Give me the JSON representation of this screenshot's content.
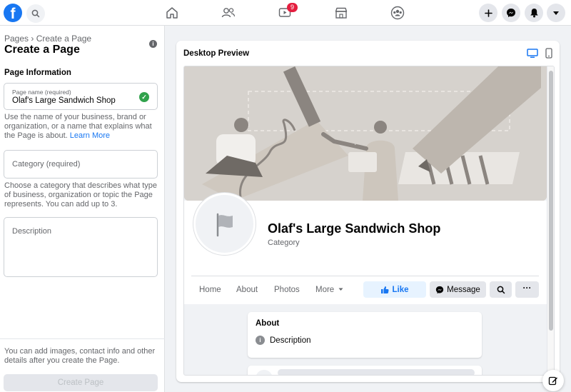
{
  "app": {
    "logo_text": "f",
    "accent_color": "#1877f2"
  },
  "topbar": {
    "notification_badge": "9",
    "icons": [
      "search-icon",
      "home-icon",
      "friends-icon",
      "watch-icon",
      "marketplace-icon",
      "groups-icon",
      "plus-icon",
      "messenger-icon",
      "bell-icon",
      "caret-down-icon"
    ]
  },
  "left_panel": {
    "breadcrumb_root": "Pages",
    "breadcrumb_sep": "›",
    "breadcrumb_current": "Create a Page",
    "title": "Create a Page",
    "section_title": "Page Information",
    "page_name": {
      "label": "Page name (required)",
      "value": "Olaf's Large Sandwich Shop",
      "helper": "Use the name of your business, brand or organization, or a name that explains what the Page is about.",
      "helper_link": "Learn More"
    },
    "category": {
      "placeholder": "Category (required)",
      "helper": "Choose a category that describes what type of business, organization or topic the Page represents. You can add up to 3."
    },
    "description": {
      "placeholder": "Description"
    },
    "bottom_note": "You can add images, contact info and other details after you create the Page.",
    "create_button": "Create Page"
  },
  "preview": {
    "title": "Desktop Preview",
    "page_name": "Olaf's Large Sandwich Shop",
    "category": "Category",
    "tabs": [
      "Home",
      "About",
      "Photos",
      "More"
    ],
    "like_button": "Like",
    "message_button": "Message",
    "more_button": "···",
    "about_title": "About",
    "about_description": "Description"
  }
}
